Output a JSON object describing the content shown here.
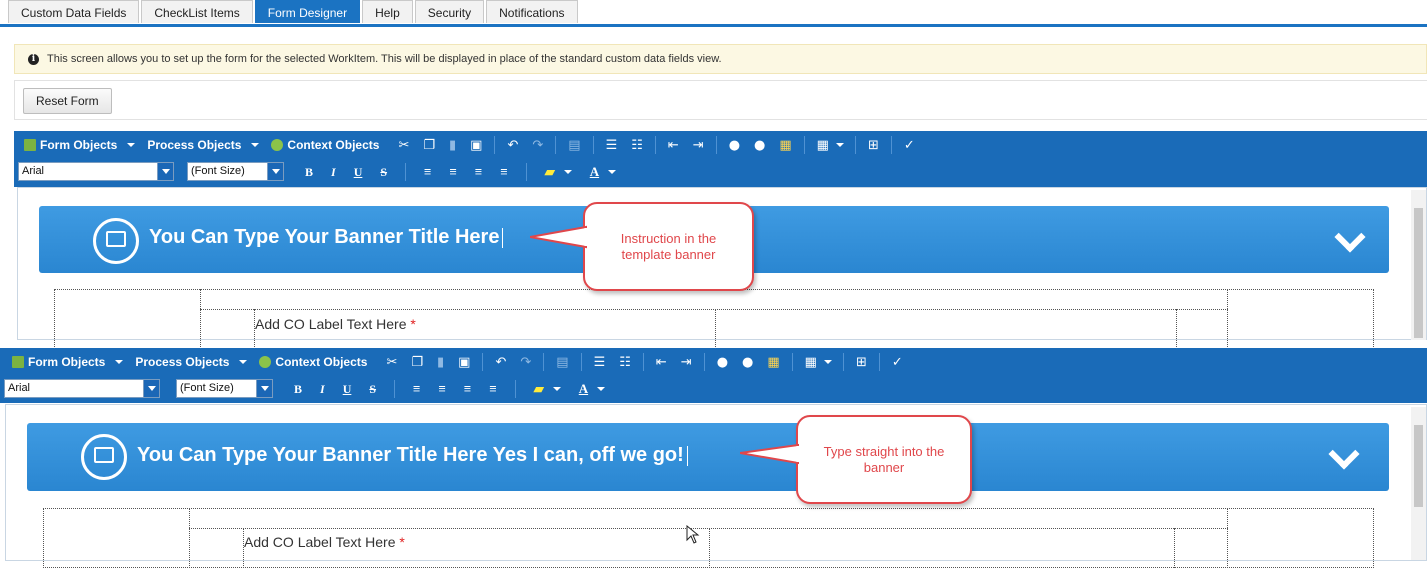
{
  "tabs": [
    "Custom Data Fields",
    "CheckList Items",
    "Form Designer",
    "Help",
    "Security",
    "Notifications"
  ],
  "active_tab": "Form Designer",
  "info_text": "This screen allows you to set up the form for the selected WorkItem. This will be displayed in place of the standard custom data fields view.",
  "reset_button": "Reset Form",
  "toolbar": {
    "form_objects": "Form Objects",
    "process_objects": "Process Objects",
    "context_objects": "Context Objects",
    "font": "Arial",
    "font_size": "(Font Size)",
    "bold": "B",
    "italic": "I",
    "underline": "U",
    "strike": "S"
  },
  "top_editor": {
    "banner_title": "You Can Type Your Banner Title Here",
    "callout": "Instruction in the template banner",
    "field_label": "Add CO Label Text Here",
    "required_mark": "*"
  },
  "bottom_editor": {
    "banner_title": "You Can Type Your Banner Title Here Yes I can, off we go!",
    "callout": "Type straight into the banner",
    "field_label": "Add CO Label Text Here",
    "required_mark": "*"
  },
  "colors": {
    "accent": "#1b73c2",
    "toolbar": "#1a6bb8",
    "banner": "#3a95dd",
    "callout_border": "#e0474b",
    "info_bg": "#fcf8e3"
  }
}
